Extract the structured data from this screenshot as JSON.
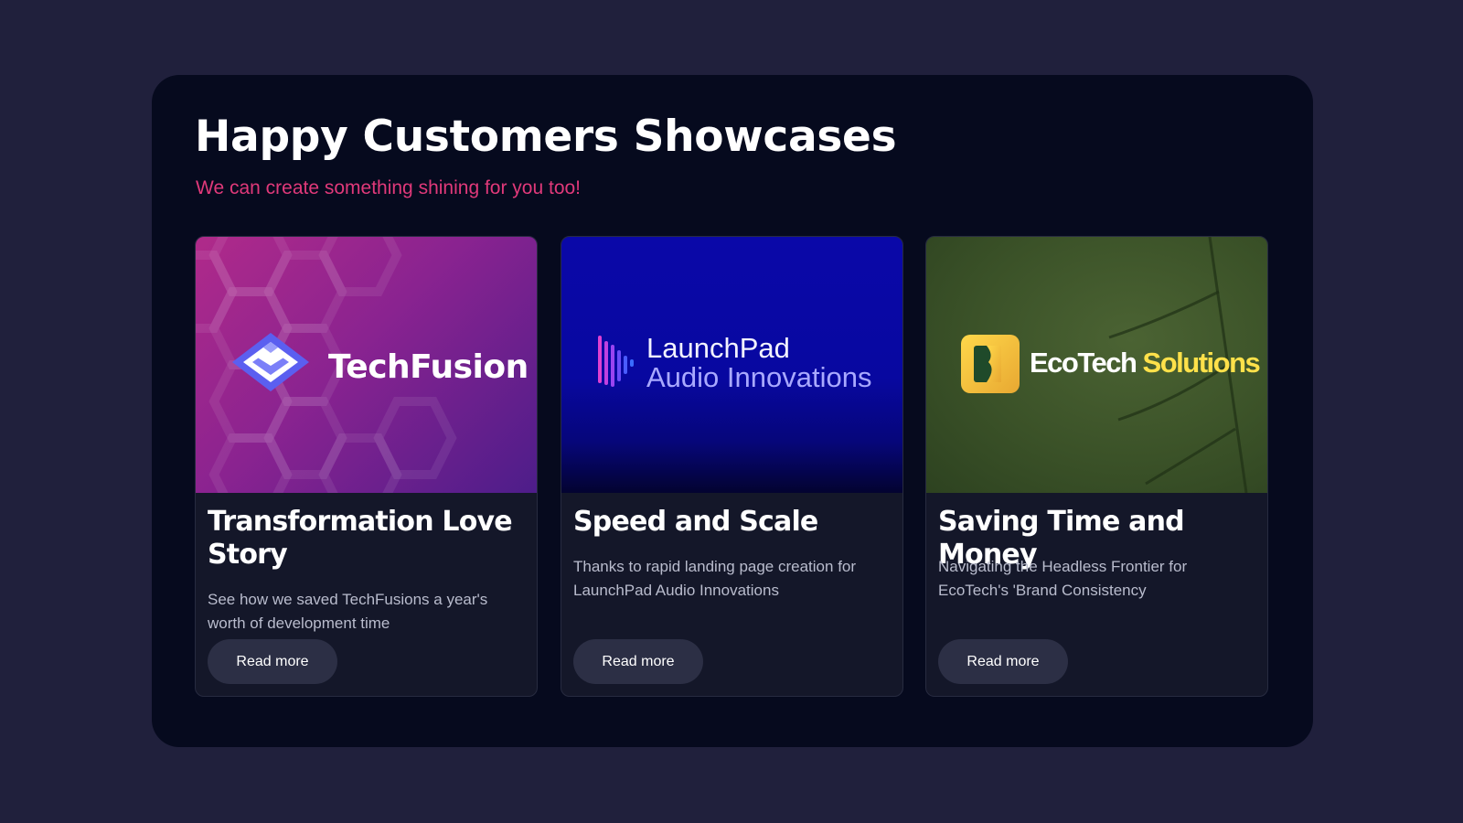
{
  "header": {
    "title": "Happy Customers Showcases",
    "subtitle": "We can create something shining for you too!"
  },
  "colors": {
    "page_bg": "#20203c",
    "panel_bg": "#060a1e",
    "accent": "#e0397a",
    "card_bg": "#141729",
    "button_bg": "#2c2f45"
  },
  "cards": [
    {
      "logo_text": "TechFusion",
      "logo_icon": "layered-diamond-icon",
      "title": "Transformation Love Story",
      "description": "See how we saved TechFusions a year's worth of development time",
      "button_label": "Read more"
    },
    {
      "logo_line1": "LaunchPad",
      "logo_line2": "Audio Innovations",
      "logo_icon": "sound-wave-icon",
      "title": "Speed and Scale",
      "description": "Thanks to rapid landing page creation for LaunchPad Audio Innovations",
      "button_label": "Read more"
    },
    {
      "logo_text_a": "EcoTech",
      "logo_text_b": "Solutions",
      "logo_icon": "letter-e-badge-icon",
      "title": "Saving Time and Money",
      "description": "Navigating the Headless Frontier for EcoTech's 'Brand Consistency",
      "button_label": "Read more"
    }
  ]
}
